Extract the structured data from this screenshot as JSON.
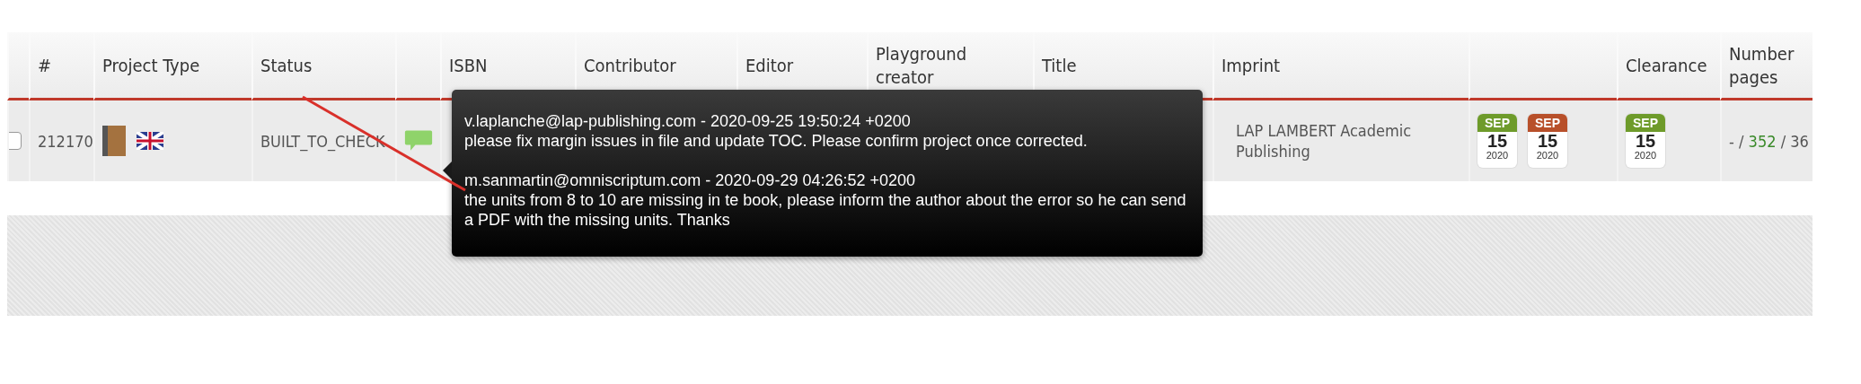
{
  "table": {
    "columns": [
      {
        "kind": "blank"
      },
      {
        "kind": "text",
        "label": "#"
      },
      {
        "kind": "text",
        "label": "Project Type"
      },
      {
        "kind": "text",
        "label": "Status"
      },
      {
        "kind": "blank"
      },
      {
        "kind": "text",
        "label": "ISBN"
      },
      {
        "kind": "text",
        "label": "Contributor"
      },
      {
        "kind": "text",
        "label": "Editor"
      },
      {
        "kind": "text",
        "label": "Playground creator"
      },
      {
        "kind": "text",
        "label": "Title"
      },
      {
        "kind": "text",
        "label": "Imprint"
      },
      {
        "kind": "blank"
      },
      {
        "kind": "text",
        "label": "Clearance"
      },
      {
        "kind": "text",
        "label": "Number pages"
      }
    ],
    "rows": [
      {
        "checked": false,
        "id": "212170",
        "status": "BUILT_TO_CHECK",
        "imprint": "LAP LAMBERT Academic Publishing",
        "dates": [
          {
            "month": "SEP",
            "day": "15",
            "year": "2020",
            "color": "#6e9b2a"
          },
          {
            "month": "SEP",
            "day": "15",
            "year": "2020",
            "color": "#b8502a"
          }
        ],
        "clearance": {
          "month": "SEP",
          "day": "15",
          "year": "2020",
          "color": "#6e9b2a"
        },
        "pages": {
          "prefix": "- /",
          "value": "352",
          "suffix": "/ 36"
        }
      }
    ]
  },
  "tooltip": {
    "comments": [
      {
        "header": "v.laplanche@lap-publishing.com - 2020-09-25 19:50:24 +0200",
        "text": "please fix margin issues in file and update TOC. Please confirm project once corrected."
      },
      {
        "header": "m.sanmartin@omniscriptum.com - 2020-09-29 04:26:52 +0200",
        "text": "the units from 8 to 10 are missing in te book, please inform the author about the error so he can send a PDF with the missing units. Thanks"
      }
    ]
  }
}
